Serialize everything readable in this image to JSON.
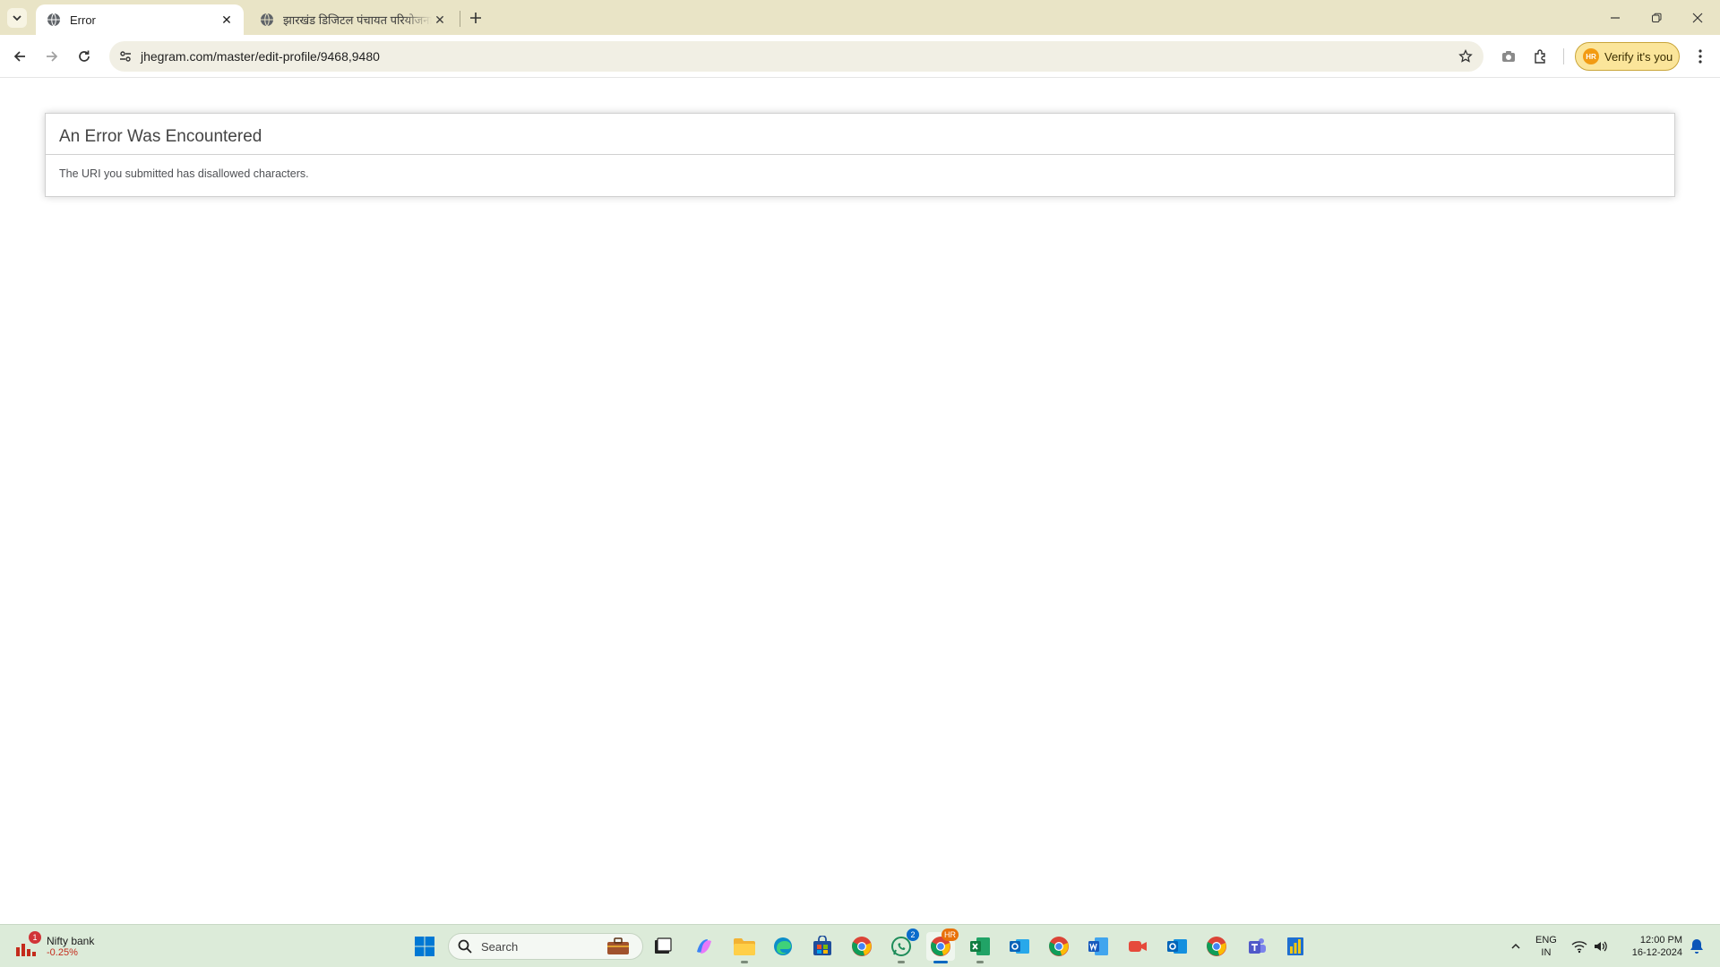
{
  "browser": {
    "tabs": [
      {
        "title": "Error",
        "active": true
      },
      {
        "title": "झारखंड डिजिटल पंचायत परियोजना",
        "active": false
      }
    ],
    "url": "jhegram.com/master/edit-profile/9468,9480",
    "verify_label": "Verify it's you",
    "profile_initials": "HR"
  },
  "page": {
    "heading": "An Error Was Encountered",
    "message": "The URI you submitted has disallowed characters."
  },
  "taskbar": {
    "widget": {
      "title": "Nifty bank",
      "change": "-0.25%",
      "badge": "1"
    },
    "search_placeholder": "Search",
    "badges": {
      "whatsapp": "2",
      "chrome": "HR"
    },
    "language": {
      "line1": "ENG",
      "line2": "IN"
    },
    "clock": {
      "time": "12:00 PM",
      "date": "16-12-2024"
    }
  },
  "colors": {
    "titlebar": "#e9e4c6",
    "taskbar": "#dcebd9",
    "verify_chip": "#fbe59a"
  }
}
